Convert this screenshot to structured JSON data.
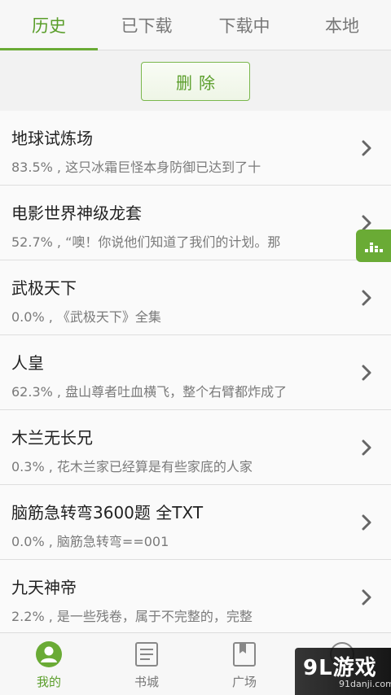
{
  "tabs": [
    {
      "label": "历史",
      "active": true
    },
    {
      "label": "已下载",
      "active": false
    },
    {
      "label": "下载中",
      "active": false
    },
    {
      "label": "本地",
      "active": false
    }
  ],
  "delete_button": {
    "label": "删除"
  },
  "history": [
    {
      "title": "地球试炼场",
      "subtitle": "83.5% , 这只冰霜巨怪本身防御已达到了十"
    },
    {
      "title": "电影世界神级龙套",
      "subtitle": "52.7% , “噢！你说他们知道了我们的计划。那"
    },
    {
      "title": "武极天下",
      "subtitle": "0.0% , 《武极天下》全集"
    },
    {
      "title": "人皇",
      "subtitle": "62.3% , 盘山尊者吐血横飞，整个右臂都炸成了"
    },
    {
      "title": "木兰无长兄",
      "subtitle": "0.3% , 花木兰家已经算是有些家底的人家"
    },
    {
      "title": "脑筋急转弯3600题 全TXT",
      "subtitle": "0.0% , 脑筋急转弯==001"
    },
    {
      "title": "九天神帝",
      "subtitle": "2.2% , 是一些残卷，属于不完整的，完整"
    }
  ],
  "side_button": {
    "icon": "equalizer-icon"
  },
  "bottom_nav": [
    {
      "label": "我的",
      "icon": "user-icon",
      "active": true
    },
    {
      "label": "书城",
      "icon": "document-icon",
      "active": false
    },
    {
      "label": "广场",
      "icon": "bookmark-book-icon",
      "active": false
    },
    {
      "label": "",
      "icon": "circle-icon",
      "active": false
    }
  ],
  "watermark": {
    "main": "9L游戏",
    "sub": "91danji.com"
  },
  "colors": {
    "accent": "#6aab35",
    "text": "#222222",
    "subtext": "#7a7a7a",
    "background": "#f2f2f2"
  }
}
